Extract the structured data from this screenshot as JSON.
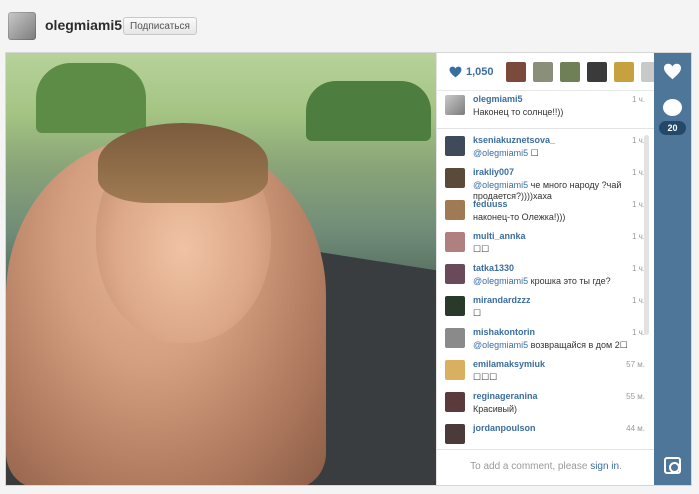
{
  "profile": {
    "username": "olegmiami5",
    "follow_label": "Подписаться"
  },
  "post": {
    "likes": "1,050",
    "caption": {
      "user": "olegmiami5",
      "time": "1 ч.",
      "text": "Наконец то солнце!!))"
    }
  },
  "likers": [
    {
      "color": "#7a4a3a"
    },
    {
      "color": "#8a8f7a"
    },
    {
      "color": "#6f7f56"
    },
    {
      "color": "#3a3a3a"
    },
    {
      "color": "#c7a040"
    },
    {
      "color": "#c9c9c9"
    }
  ],
  "comments": [
    {
      "user": "kseniakuznetsova_",
      "time": "1 ч.",
      "mention": "@olegmiami5",
      "text": " ☐",
      "color": "#3f4a5a"
    },
    {
      "user": "irakliy007",
      "time": "1 ч.",
      "mention": "@olegmiami5",
      "text": " че много народу ?чай продается?))))хаха",
      "color": "#5a4a3a"
    },
    {
      "user": "feduuss",
      "time": "1 ч.",
      "mention": "",
      "text": "наконец-то Олежка!)))",
      "color": "#a07a55"
    },
    {
      "user": "multi_annka",
      "time": "1 ч.",
      "mention": "",
      "text": "☐☐",
      "color": "#b08080"
    },
    {
      "user": "tatka1330",
      "time": "1 ч.",
      "mention": "@olegmiami5",
      "text": " крошка это ты где?",
      "color": "#6a4a5a"
    },
    {
      "user": "mirandardzzz",
      "time": "1 ч.",
      "mention": "",
      "text": "☐",
      "color": "#2a3a2a"
    },
    {
      "user": "mishakontorin",
      "time": "1 ч.",
      "mention": "@olegmiami5",
      "text": " возвращайся в дом 2☐",
      "color": "#8a8a8a"
    },
    {
      "user": "emilamaksymiuk",
      "time": "57 м.",
      "mention": "",
      "text": "☐☐☐",
      "color": "#d8b060"
    },
    {
      "user": "reginageranina",
      "time": "55 м.",
      "mention": "",
      "text": "Красивый)",
      "color": "#5a3a3a"
    },
    {
      "user": "jordanpoulson",
      "time": "44 м.",
      "mention": "",
      "text": "",
      "color": "#4a3a3a"
    }
  ],
  "add_comment": {
    "prefix": "To add a comment, please ",
    "link": "sign in",
    "suffix": "."
  },
  "rail": {
    "comment_count": "20"
  },
  "colors": {
    "accent": "#4e7698",
    "link": "#3b6ea0"
  },
  "icons": [
    "heart-icon",
    "comment-bubble-icon",
    "instagram-camera-icon"
  ]
}
